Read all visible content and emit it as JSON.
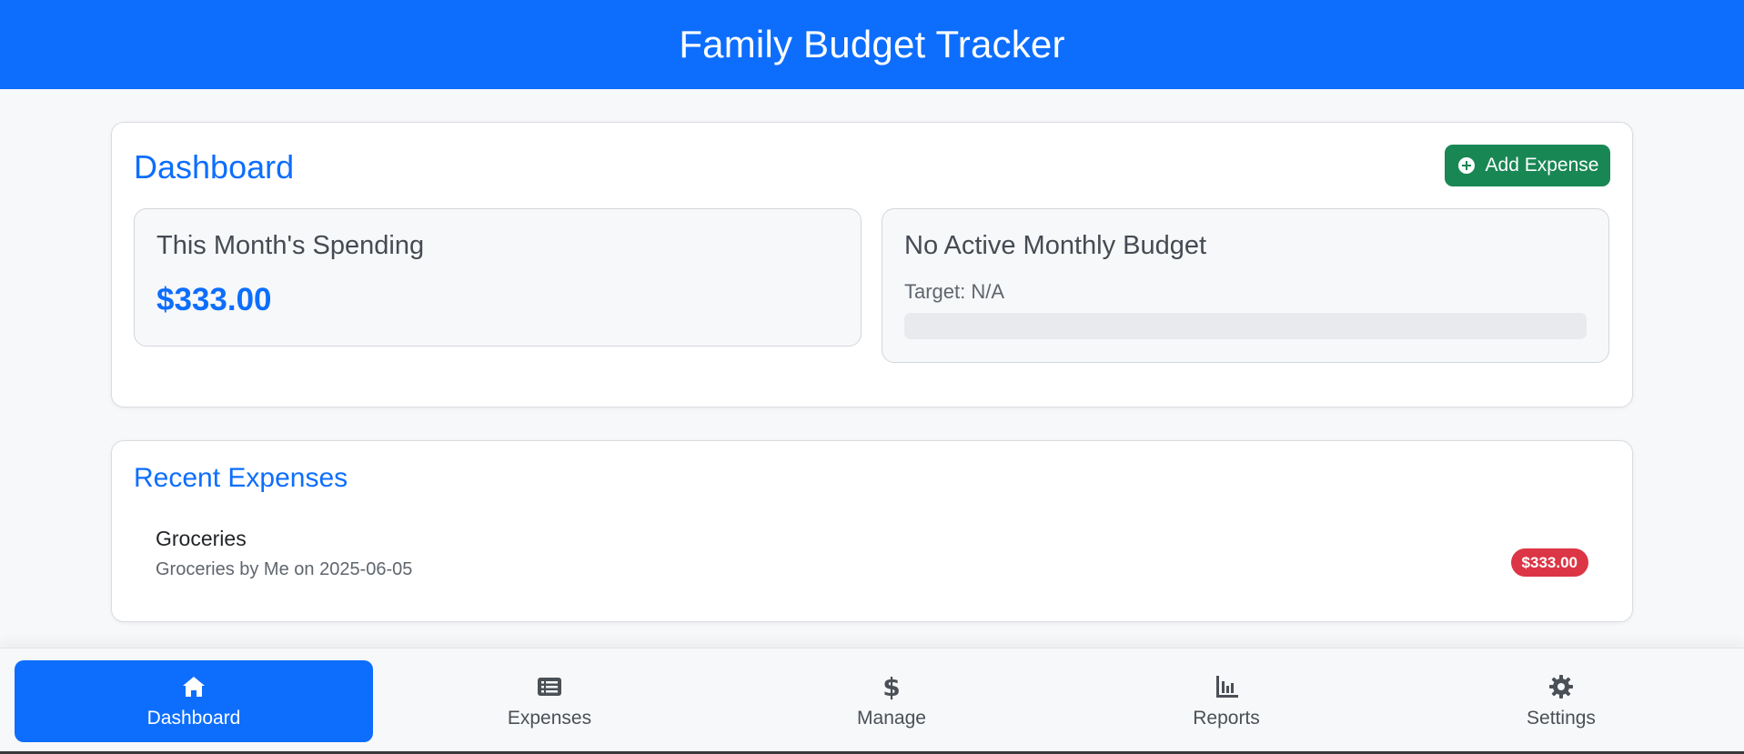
{
  "header": {
    "title": "Family Budget Tracker"
  },
  "dashboard": {
    "title": "Dashboard",
    "add_button_label": "Add Expense",
    "spending": {
      "title": "This Month's Spending",
      "amount": "$333.00"
    },
    "budget": {
      "title": "No Active Monthly Budget",
      "target": "Target: N/A",
      "progress_percent": 0
    }
  },
  "recent": {
    "title": "Recent Expenses",
    "items": [
      {
        "name": "Groceries",
        "description": "Groceries by Me on 2025-06-05",
        "amount": "$333.00"
      }
    ]
  },
  "nav": {
    "items": [
      {
        "label": "Dashboard",
        "icon": "home-icon",
        "active": true
      },
      {
        "label": "Expenses",
        "icon": "list-icon",
        "active": false
      },
      {
        "label": "Manage",
        "icon": "dollar-icon",
        "active": false
      },
      {
        "label": "Reports",
        "icon": "chart-icon",
        "active": false
      },
      {
        "label": "Settings",
        "icon": "gear-icon",
        "active": false
      }
    ]
  },
  "colors": {
    "primary": "#0d6efd",
    "success": "#198754",
    "danger": "#dc3545",
    "background": "#f7f8fa"
  }
}
